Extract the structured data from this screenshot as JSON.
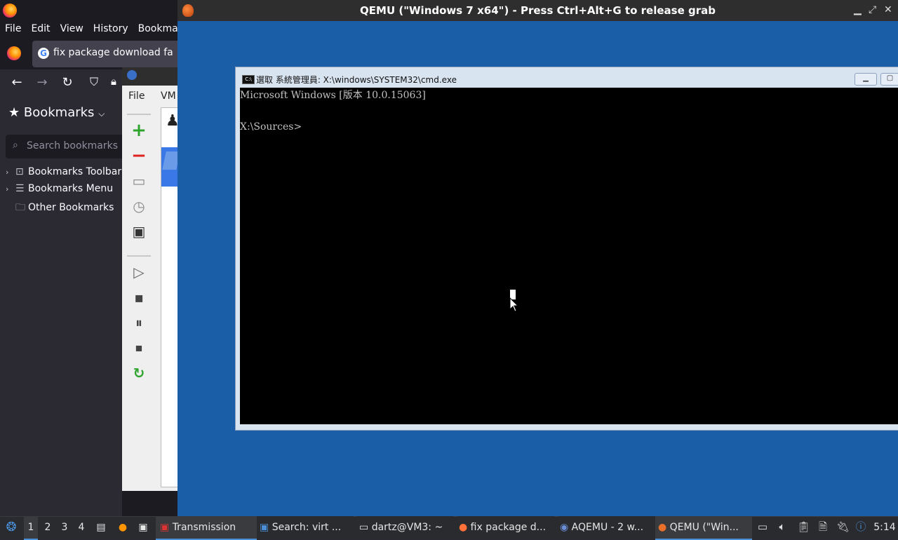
{
  "firefox": {
    "menu": [
      "File",
      "Edit",
      "View",
      "History",
      "Bookmark"
    ],
    "tab_title": "fix package download fa",
    "sidebar": {
      "header": "Bookmarks",
      "search_placeholder": "Search bookmarks",
      "items": [
        {
          "label": "Bookmarks Toolbar",
          "icon": "star-folder-icon"
        },
        {
          "label": "Bookmarks Menu",
          "icon": "menu-icon"
        },
        {
          "label": "Other Bookmarks",
          "icon": "folder-icon"
        }
      ]
    }
  },
  "virt_manager": {
    "menu": [
      "File",
      "VM"
    ]
  },
  "qemu": {
    "title": "QEMU (\"Windows 7 x64\") - Press Ctrl+Alt+G to release grab",
    "cmd_window": {
      "title": "選取 系統管理員: X:\\windows\\SYSTEM32\\cmd.exe",
      "icon_text": "C:\\",
      "lines": [
        "Microsoft Windows [版本 10.0.15063]",
        "",
        "X:\\Sources>"
      ]
    }
  },
  "taskbar": {
    "desktops": [
      "1",
      "2",
      "3",
      "4"
    ],
    "tasks": [
      {
        "label": "Transmission",
        "icon": "transmission-icon"
      },
      {
        "label": "Search: virt ...",
        "icon": "search-window-icon"
      },
      {
        "label": "dartz@VM3: ~",
        "icon": "terminal-icon"
      },
      {
        "label": "fix package d...",
        "icon": "firefox-icon"
      },
      {
        "label": "AQEMU - 2 w...",
        "icon": "aqemu-icon"
      },
      {
        "label": "QEMU (\"Win...",
        "icon": "qemu-icon"
      }
    ],
    "clock": "5:14"
  }
}
